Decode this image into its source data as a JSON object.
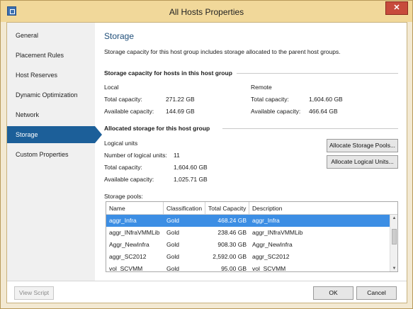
{
  "window": {
    "title": "All Hosts Properties",
    "close_glyph": "✕"
  },
  "nav": {
    "items": [
      {
        "label": "General"
      },
      {
        "label": "Placement Rules"
      },
      {
        "label": "Host Reserves"
      },
      {
        "label": "Dynamic Optimization"
      },
      {
        "label": "Network"
      },
      {
        "label": "Storage"
      },
      {
        "label": "Custom Properties"
      }
    ],
    "active": "Storage"
  },
  "storage": {
    "title": "Storage",
    "intro": "Storage capacity for this host group includes storage allocated to the parent host groups.",
    "capacity_section": "Storage capacity for hosts in this host group",
    "local": {
      "heading": "Local",
      "total_label": "Total capacity:",
      "total_value": "271.22 GB",
      "available_label": "Available capacity:",
      "available_value": "144.69 GB"
    },
    "remote": {
      "heading": "Remote",
      "total_label": "Total capacity:",
      "total_value": "1,604.60 GB",
      "available_label": "Available capacity:",
      "available_value": "466.64 GB"
    },
    "allocated_section": "Allocated storage for this host group",
    "logical_units": {
      "heading": "Logical units",
      "count_label": "Number of logical units:",
      "count_value": "11",
      "total_label": "Total capacity:",
      "total_value": "1,604.60 GB",
      "available_label": "Available capacity:",
      "available_value": "1,025.71 GB"
    },
    "allocate_pools_button": "Allocate Storage Pools...",
    "allocate_luns_button": "Allocate Logical Units...",
    "pools_label": "Storage pools:",
    "pools_table": {
      "columns": [
        "Name",
        "Classification",
        "Total Capacity",
        "Description"
      ],
      "rows": [
        {
          "name": "aggr_Infra",
          "classification": "Gold",
          "total": "468.24 GB",
          "description": "aggr_Infra",
          "selected": true
        },
        {
          "name": "aggr_INfraVMMLib",
          "classification": "Gold",
          "total": "238.46 GB",
          "description": "aggr_INfraVMMLib",
          "selected": false
        },
        {
          "name": "Aggr_NewInfra",
          "classification": "Gold",
          "total": "908.30 GB",
          "description": "Aggr_NewInfra",
          "selected": false
        },
        {
          "name": "aggr_SC2012",
          "classification": "Gold",
          "total": "2,592.00 GB",
          "description": "aggr_SC2012",
          "selected": false
        },
        {
          "name": "vol_SCVMM",
          "classification": "Gold",
          "total": "95.00 GB",
          "description": "vol_SCVMM",
          "selected": false
        }
      ]
    }
  },
  "footer": {
    "view_script": "View Script",
    "ok": "OK",
    "cancel": "Cancel"
  },
  "icons": {
    "app": "app-window-icon",
    "scroll_up": "▲",
    "scroll_down": "▼"
  },
  "colors": {
    "title_bar": "#f1d89a",
    "nav_active": "#1c5f99",
    "row_selected": "#3c8ee4",
    "heading": "#1f4e79",
    "close": "#c74b3c"
  }
}
